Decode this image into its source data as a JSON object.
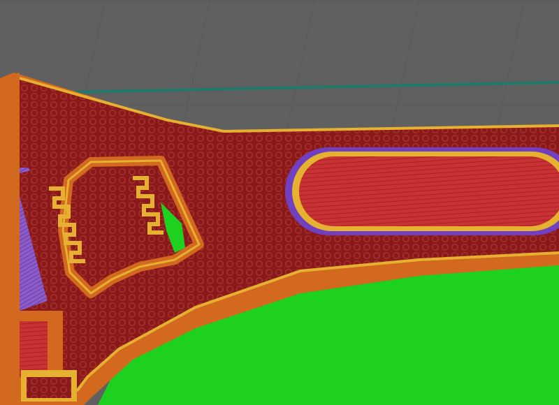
{
  "viewport": {
    "background_color": "#606060",
    "grid_color": "#555555",
    "build_plate_edge_color": "#1f7a6a"
  },
  "toolpath_colors": {
    "outer_wall": "#d2691e",
    "inner_wall": "#e6b030",
    "top_bottom_skin": "#c83232",
    "infill": "#8a1a1a",
    "support": "#8c5cc8",
    "skirt_brim": "#1fd11f",
    "support_interface": "#7040c0"
  },
  "model": {
    "icon": "wrench-model-icon",
    "features": [
      "handle-slot",
      "adjustable-jaw",
      "worm-screw"
    ]
  }
}
